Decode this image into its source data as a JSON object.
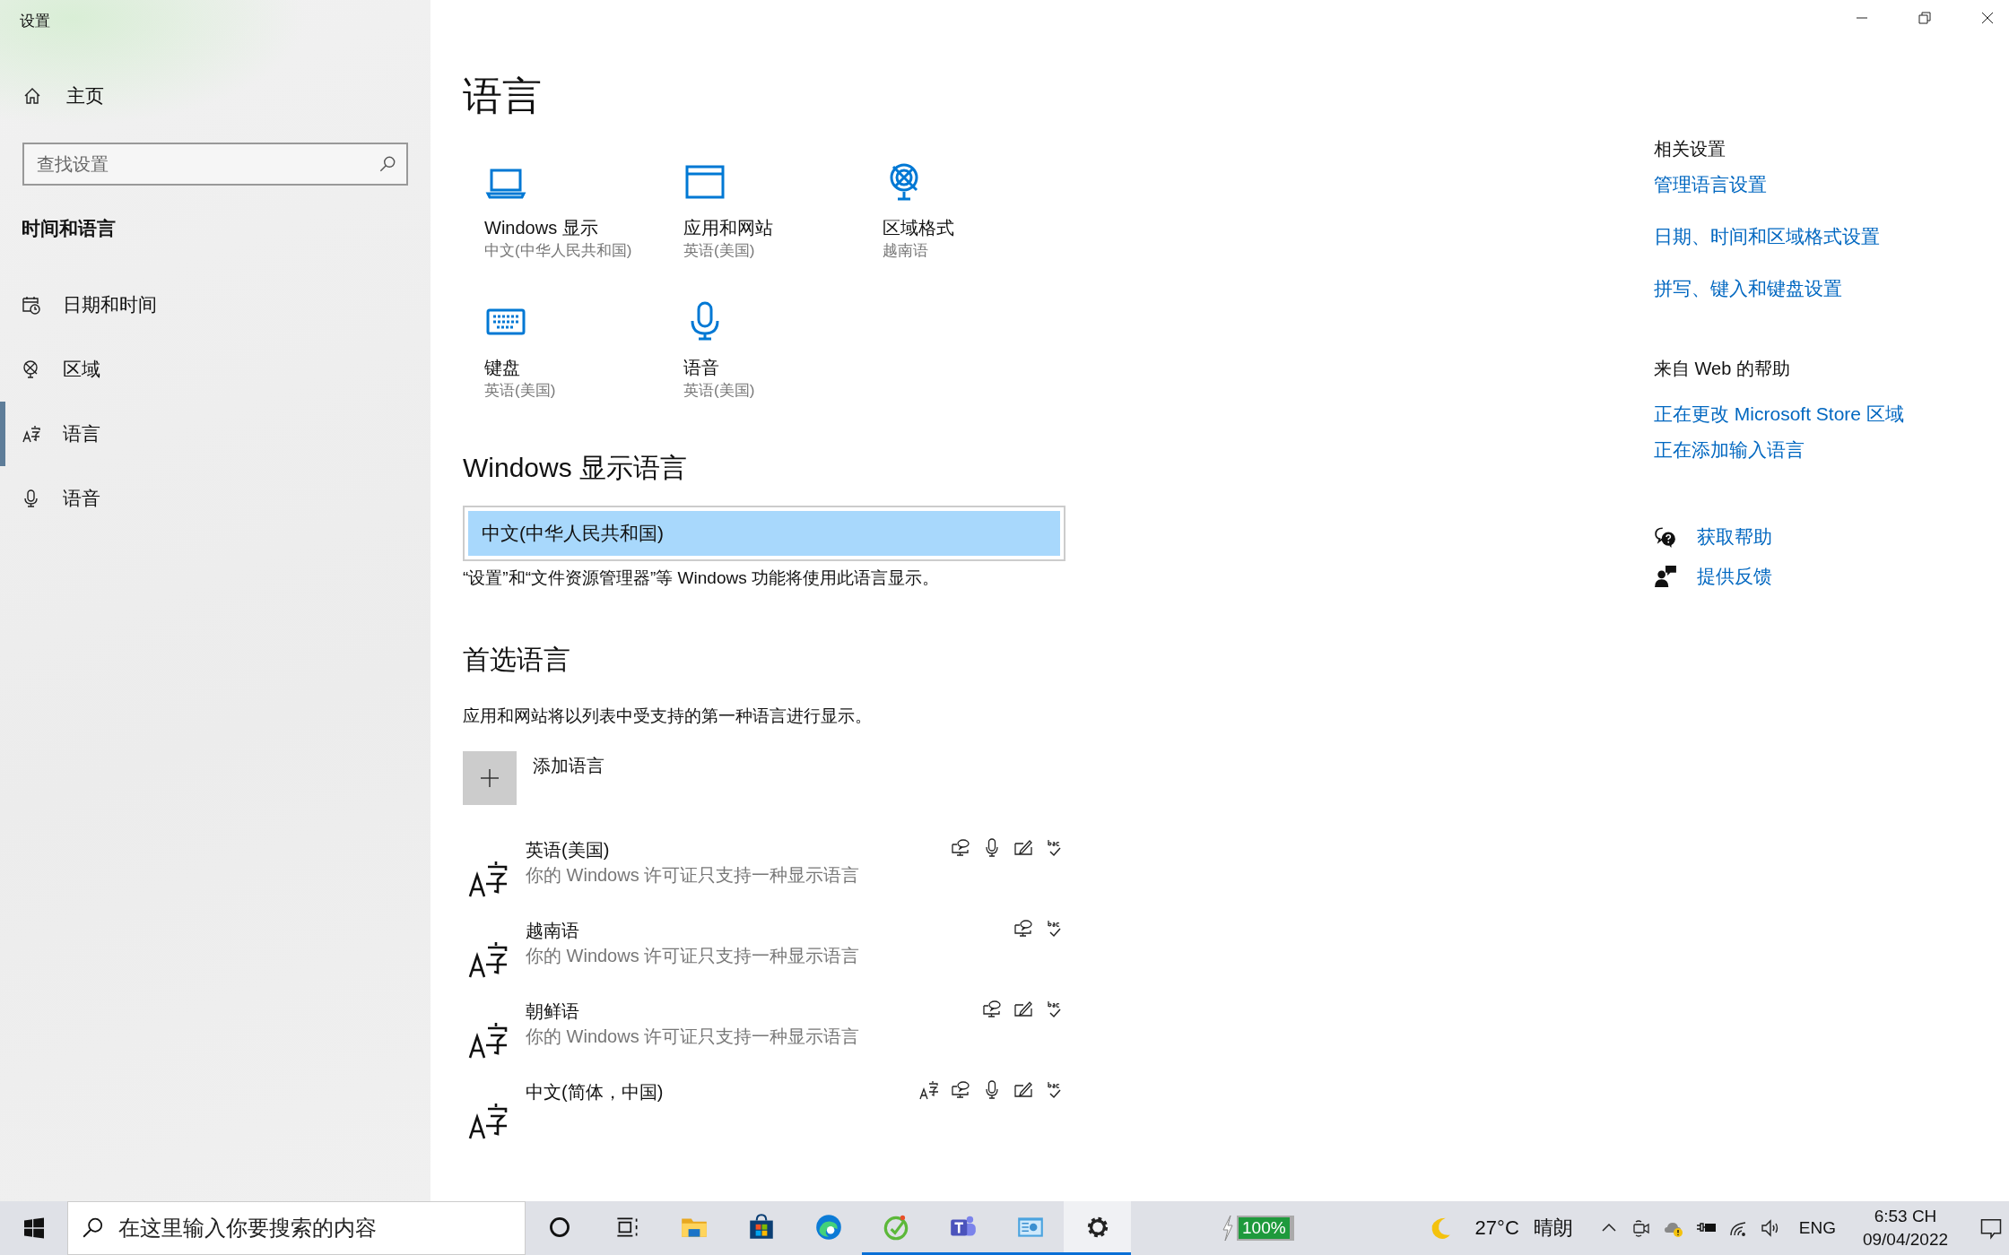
{
  "window": {
    "title": "设置"
  },
  "sidebar": {
    "home": "主页",
    "search": {
      "placeholder": "查找设置"
    },
    "section": "时间和语言",
    "items": [
      {
        "label": "日期和时间",
        "kind": "calendar",
        "selected": false
      },
      {
        "label": "区域",
        "kind": "globe",
        "selected": false
      },
      {
        "label": "语言",
        "kind": "language",
        "selected": true
      },
      {
        "label": "语音",
        "kind": "microphone",
        "selected": false
      }
    ]
  },
  "page": {
    "title": "语言",
    "tiles": [
      {
        "kind": "laptop",
        "label": "Windows 显示",
        "value": "中文(中华人民共和国)"
      },
      {
        "kind": "window",
        "label": "应用和网站",
        "value": "英语(美国)"
      },
      {
        "kind": "globe",
        "label": "区域格式",
        "value": "越南语"
      },
      {
        "kind": "keyboard",
        "label": "键盘",
        "value": "英语(美国)"
      },
      {
        "kind": "microphone",
        "label": "语音",
        "value": "英语(美国)"
      }
    ],
    "display_language": {
      "heading": "Windows 显示语言",
      "value": "中文(中华人民共和国)",
      "note": "“设置”和“文件资源管理器”等 Windows 功能将使用此语言显示。"
    },
    "preferred": {
      "heading": "首选语言",
      "description": "应用和网站将以列表中受支持的第一种语言进行显示。",
      "add_label": "添加语言",
      "languages": [
        {
          "name": "英语(美国)",
          "note": "你的 Windows 许可证只支持一种显示语言",
          "features": [
            {
              "kind": "display"
            },
            {
              "kind": "speech"
            },
            {
              "kind": "handwriting"
            },
            {
              "kind": "spelling"
            }
          ]
        },
        {
          "name": "越南语",
          "note": "你的 Windows 许可证只支持一种显示语言",
          "features": [
            {
              "kind": "display"
            },
            {
              "kind": "spelling"
            }
          ]
        },
        {
          "name": "朝鲜语",
          "note": "你的 Windows 许可证只支持一种显示语言",
          "features": [
            {
              "kind": "display"
            },
            {
              "kind": "handwriting"
            },
            {
              "kind": "spelling"
            }
          ]
        },
        {
          "name": "中文(简体，中国)",
          "features": [
            {
              "kind": "language-pack"
            },
            {
              "kind": "display"
            },
            {
              "kind": "speech"
            },
            {
              "kind": "handwriting"
            },
            {
              "kind": "spelling"
            }
          ]
        }
      ]
    }
  },
  "related": {
    "heading": "相关设置",
    "links": [
      "管理语言设置",
      "日期、时间和区域格式设置",
      "拼写、键入和键盘设置"
    ]
  },
  "web_help": {
    "heading": "来自 Web 的帮助",
    "links": [
      "正在更改 Microsoft Store 区域",
      "正在添加输入语言"
    ]
  },
  "support": [
    {
      "kind": "help",
      "label": "获取帮助"
    },
    {
      "kind": "feedback",
      "label": "提供反馈"
    }
  ],
  "taskbar": {
    "search": {
      "placeholder": "在这里输入你要搜索的内容"
    },
    "apps": [
      {
        "kind": "cortana",
        "running": false,
        "selected": false
      },
      {
        "kind": "task-view",
        "running": false,
        "selected": false
      },
      {
        "kind": "folder",
        "running": false,
        "selected": false
      },
      {
        "kind": "store",
        "running": false,
        "selected": false
      },
      {
        "kind": "edge",
        "running": false,
        "selected": false
      },
      {
        "kind": "leaf",
        "running": true,
        "selected": false
      },
      {
        "kind": "teams",
        "running": true,
        "selected": false
      },
      {
        "kind": "panel",
        "running": true,
        "selected": false
      },
      {
        "kind": "settings",
        "running": true,
        "selected": true
      }
    ],
    "battery": "100%",
    "weather": {
      "temperature": "27°C",
      "condition": "晴朗"
    },
    "tray": [
      {
        "kind": "chevron"
      },
      {
        "kind": "camera"
      },
      {
        "kind": "cloud"
      },
      {
        "kind": "plug"
      },
      {
        "kind": "wifi"
      },
      {
        "kind": "speaker"
      }
    ],
    "language": "ENG",
    "time": "6:53 CH",
    "date": "09/04/2022"
  }
}
